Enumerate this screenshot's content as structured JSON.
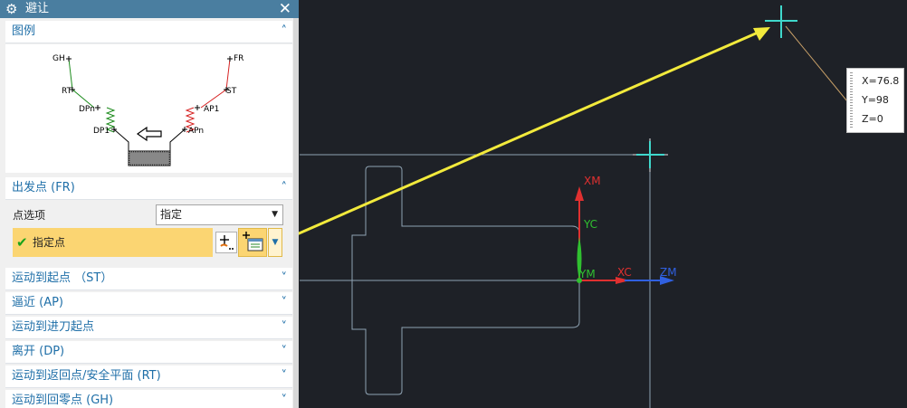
{
  "dialog": {
    "title": "避让",
    "sections": {
      "legend": "图例",
      "from_point": "出发点 (FR)",
      "start_point": "运动到起点 （ST）",
      "approach": "逼近 (AP)",
      "engage_start": "运动到进刀起点",
      "depart": "离开 (DP)",
      "return_point": "运动到返回点/安全平面 (RT)",
      "gohome": "运动到回零点 (GH)"
    },
    "point_option_label": "点选项",
    "point_option_value": "指定",
    "specify_point_label": "指定点"
  },
  "legend_diagram": {
    "labels": [
      "GH",
      "RT",
      "DPn",
      "DP1",
      "FR",
      "ST",
      "AP1",
      "APn"
    ]
  },
  "viewport": {
    "axes": {
      "xm": "XM",
      "yc": "YC",
      "ym": "YM",
      "xc": "XC",
      "zm": "ZM"
    },
    "coords": {
      "x": "X=76.8",
      "y": "Y=98",
      "z": "Z=0"
    }
  },
  "colors": {
    "accent": "#1f6fa8",
    "title_bar": "#4a7ea0",
    "highlight": "#fbd572",
    "viewport_bg": "#1e2127"
  }
}
